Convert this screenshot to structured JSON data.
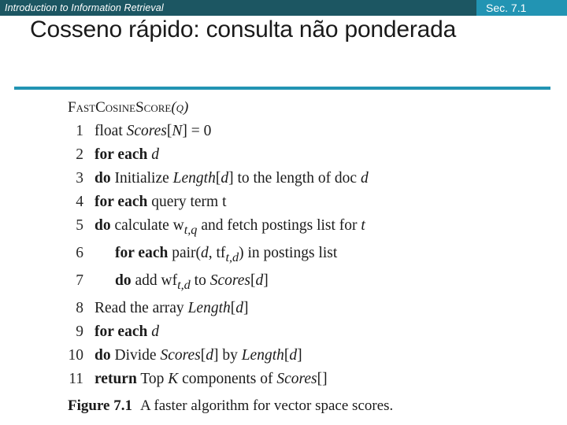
{
  "header": {
    "course_title": "Introduction to Information Retrieval",
    "section_badge": "Sec. 7.1",
    "bar_color": "#1c5662",
    "badge_color": "#2294b3"
  },
  "slide": {
    "title": "Cosseno rápido: consulta não ponderada",
    "rule_color": "#2294b3"
  },
  "figure": {
    "algorithm_name": "FastCosineScore",
    "algorithm_arg": "(q)",
    "lines": [
      {
        "n": "1",
        "indent": 0,
        "html": "float <i>Scores</i>[<i>N</i>] = 0"
      },
      {
        "n": "2",
        "indent": 0,
        "html": "<b>for each</b> <i>d</i>"
      },
      {
        "n": "3",
        "indent": 0,
        "html": "<b>do</b> Initialize <i>Length</i>[<i>d</i>] to the length of doc <i>d</i>"
      },
      {
        "n": "4",
        "indent": 0,
        "html": "<b>for each</b> query term t"
      },
      {
        "n": "5",
        "indent": 0,
        "html": "<b>do</b> calculate w<sub><i>t,q</i></sub> and fetch postings list for <i>t</i>"
      },
      {
        "n": "6",
        "indent": 1,
        "html": "<b>for each</b> pair(<i>d</i>, tf<sub><i>t,d</i></sub>) in postings list"
      },
      {
        "n": "7",
        "indent": 1,
        "html": "<b>do</b> add wf<sub><i>t,d</i></sub> to <i>Scores</i>[<i>d</i>]"
      },
      {
        "n": "8",
        "indent": 0,
        "html": "Read the array <i>Length</i>[<i>d</i>]"
      },
      {
        "n": "9",
        "indent": 0,
        "html": "<b>for each</b> <i>d</i>"
      },
      {
        "n": "10",
        "indent": 0,
        "html": "<b>do</b> Divide <i>Scores</i>[<i>d</i>] by <i>Length</i>[<i>d</i>]"
      },
      {
        "n": "11",
        "indent": 0,
        "html": "<b>return</b> Top <i>K</i> components of <i>Scores</i>[]"
      }
    ],
    "caption_label": "Figure 7.1",
    "caption_text": "A faster algorithm for vector space scores."
  }
}
